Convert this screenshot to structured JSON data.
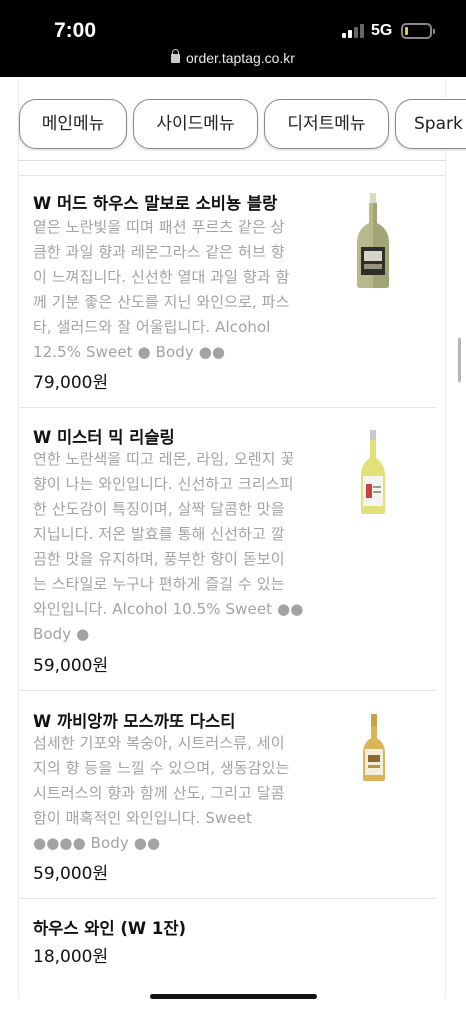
{
  "status_bar": {
    "time": "7:00",
    "network": "5G",
    "url": "order.taptag.co.kr"
  },
  "tabs": [
    {
      "label": "메인메뉴"
    },
    {
      "label": "사이드메뉴"
    },
    {
      "label": "디저트메뉴"
    },
    {
      "label": "Spark"
    }
  ],
  "items": [
    {
      "name": "W 머드 하우스 말보로 소비뇽 블랑",
      "desc_lines": [
        "옅은 노란빛을 띠며 패션 푸르츠 같은 상",
        "큼한 과일 향과 레몬그라스 같은 허브 향",
        "이 느껴집니다. 신선한 열대 과일 향과 함",
        "께 기분 좋은 산도를 지닌 와인으로, 파스",
        "타, 샐러드와 잘 어울립니다. Alcohol",
        "12.5% Sweet ● Body ●●"
      ],
      "price": "79,000원"
    },
    {
      "name": "W 미스터 믹 리슬링",
      "desc_lines": [
        "연한 노란색을 띠고 레몬, 라임, 오렌지 꽃",
        "향이 나는 와인입니다. 신선하고 크리스피",
        "한 산도감이 특징이며, 살짝 달콤한 맛을",
        "지닙니다. 저온 발효를 통해 신선하고 깔",
        "끔한 맛을 유지하며, 풍부한 향이 돋보이",
        "는 스타일로 누구나 편하게 즐길 수 있는",
        "와인입니다. Alcohol 10.5% Sweet ●●",
        "Body ●"
      ],
      "price": "59,000원"
    },
    {
      "name": "W 까비앙까 모스까또 다스티",
      "desc_lines": [
        "섬세한 기포와 복숭아, 시트러스류, 세이",
        "지의 향 등을 느낄 수 있으며, 생동감있는",
        "시트러스의 향과 함께 산도, 그리고 달콤",
        "함이 매혹적인 와인입니다. Sweet",
        "●●●● Body ●●"
      ],
      "price": "59,000원"
    },
    {
      "name": "하우스 와인 (W 1잔)",
      "desc_lines": [],
      "price": "18,000원"
    }
  ],
  "colors": {
    "status_bar_bg": "#000000",
    "desc_text": "#a3a3a3",
    "battery": "#f3c623"
  }
}
